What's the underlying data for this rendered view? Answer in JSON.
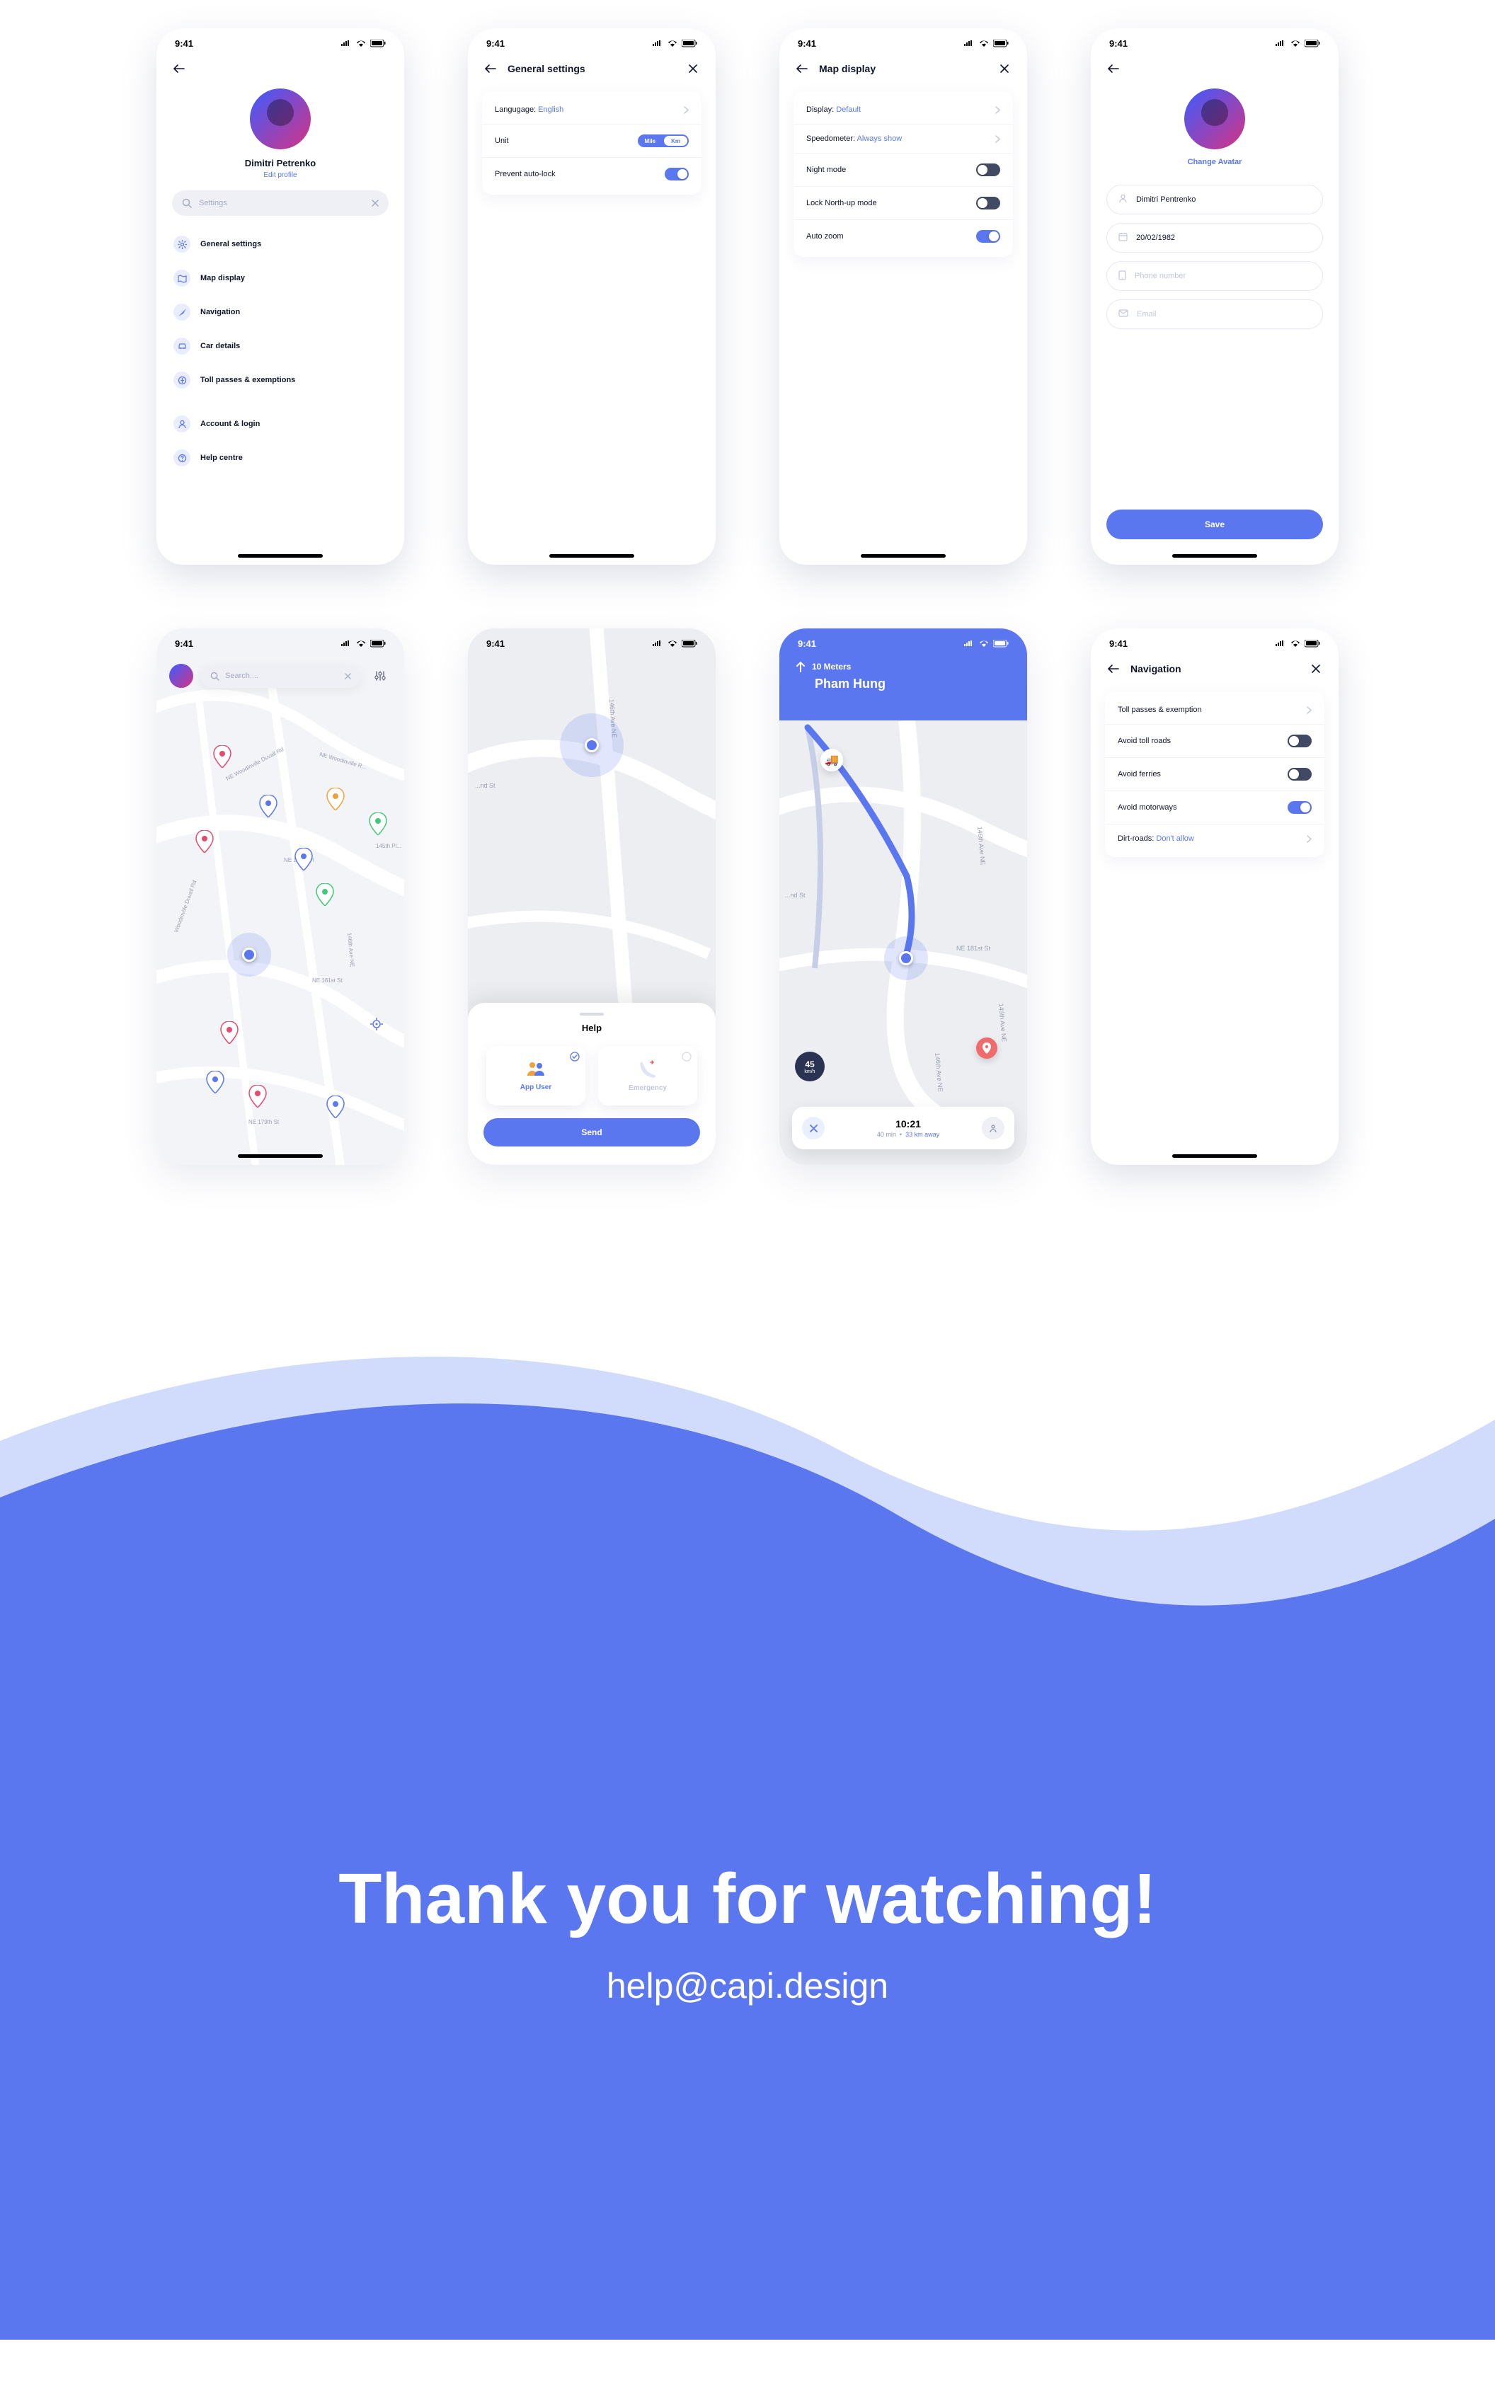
{
  "status": {
    "time": "9:41"
  },
  "screen1": {
    "user_name": "Dimitri Petrenko",
    "edit": "Edit profile",
    "search_placeholder": "Settings",
    "menu": {
      "general": "General settings",
      "map": "Map display",
      "nav": "Navigation",
      "car": "Car details",
      "toll": "Toll passes & exemptions",
      "account": "Account & login",
      "help": "Help centre"
    }
  },
  "screen2": {
    "title": "General settings",
    "language_label": "Langugage: ",
    "language_value": "English",
    "unit_label": "Unit",
    "unit_mile": "Mile",
    "unit_km": "Km",
    "autolock": "Prevent auto-lock"
  },
  "screen3": {
    "title": "Map display",
    "display_label": "Display: ",
    "display_value": "Default",
    "speed_label": "Speedometer: ",
    "speed_value": "Always show",
    "night": "Night mode",
    "lock": "Lock North-up mode",
    "zoom": "Auto zoom"
  },
  "screen4": {
    "change_avatar": "Change Avatar",
    "name": "Dimitri Pentrenko",
    "dob": "20/02/1982",
    "phone_placeholder": "Phone number",
    "email_placeholder": "Email",
    "save": "Save"
  },
  "screen5": {
    "search_placeholder": "Search....",
    "labels": {
      "road1": "NE Woodinville Duvall Rd",
      "road2": "NE Woodinville R...",
      "road3": "NE 195th Pl",
      "road4": "Woodinville Duvall Rd",
      "road5": "NE 181st St",
      "road6": "NE 179th St",
      "road7": "146th Ave NE",
      "road8": "145th Pl..."
    }
  },
  "screen6": {
    "help_title": "Help",
    "app_user": "App User",
    "emergency": "Emergency",
    "send": "Send",
    "labels": {
      "road1": "146th Ave NE",
      "road2": "...nd St"
    }
  },
  "screen7": {
    "distance": "10 Meters",
    "street": "Pham Hung",
    "speed": "45",
    "speed_unit": "km/h",
    "eta_time": "10:21",
    "eta_min": "40 min",
    "eta_km": "33 km away",
    "labels": {
      "road1": "146th Ave NE",
      "road2": "NE 181st St",
      "road3": "...nd St",
      "road4": "145th Ave NE",
      "road5": "146th Ave NE"
    }
  },
  "screen8": {
    "title": "Navigation",
    "toll": "Toll passes & exemption",
    "avoid_toll": "Avoid toll roads",
    "avoid_ferries": "Avoid ferries",
    "avoid_motor": "Avoid motorways",
    "dirt_label": "Dirt-roads: ",
    "dirt_value": "Don't allow"
  },
  "footer": {
    "headline": "Thank you for watching!",
    "email": "help@capi.design"
  }
}
